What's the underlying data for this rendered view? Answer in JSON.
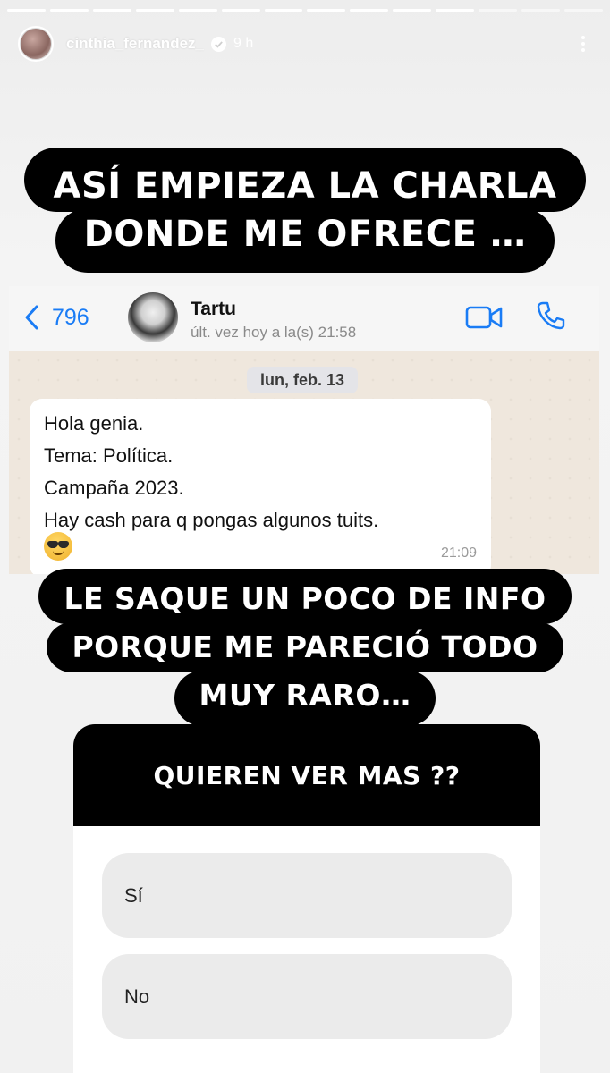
{
  "story": {
    "progress": {
      "segments": 14,
      "completed": 11
    },
    "username": "cinthia_fernandez_",
    "time_ago": "9 h",
    "caption_top": [
      "ASÍ EMPIEZA LA CHARLA",
      "DONDE ME OFRECE …"
    ],
    "caption_middle": [
      "LE SAQUE UN POCO DE INFO",
      "PORQUE ME PARECIÓ TODO",
      "MUY RARO…"
    ]
  },
  "whatsapp": {
    "back_count": "796",
    "contact_name": "Tartu",
    "last_seen": "últ. vez hoy a la(s) 21:58",
    "date_chip": "lun, feb. 13",
    "message": {
      "lines": [
        "Hola genia.",
        "Tema: Política.",
        "Campaña 2023.",
        "Hay cash para q pongas algunos tuits."
      ],
      "emoji": "sunglasses-emoji",
      "time": "21:09"
    },
    "accent_color": "#1a7cf5"
  },
  "poll": {
    "question": "QUIEREN VER MAS ??",
    "options": [
      "Sí",
      "No"
    ]
  }
}
